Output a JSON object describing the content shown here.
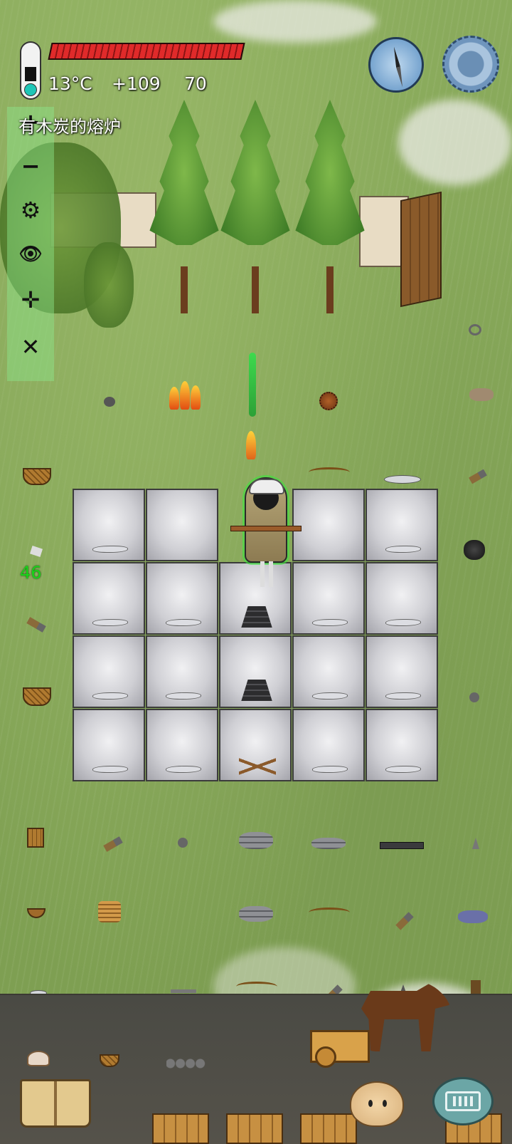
{
  "hud": {
    "temperature": "13°C",
    "food_bonus": "+109",
    "age": "70",
    "health_fraction": 1.0
  },
  "selection": {
    "label": "有木炭的熔炉"
  },
  "side_toolbar": {
    "items": [
      {
        "name": "zoom-in",
        "glyph": "+"
      },
      {
        "name": "zoom-out",
        "glyph": "−"
      },
      {
        "name": "settings",
        "glyph": "⚙"
      },
      {
        "name": "view",
        "glyph": "👁"
      },
      {
        "name": "move",
        "glyph": "✛"
      },
      {
        "name": "close",
        "glyph": "✕"
      }
    ]
  },
  "counter": {
    "value": "46"
  },
  "colors": {
    "health_red": "#e02a2a",
    "counter_green": "#19d419",
    "toolbar_green": "#8ce68c",
    "grass": "#8aab5c"
  }
}
